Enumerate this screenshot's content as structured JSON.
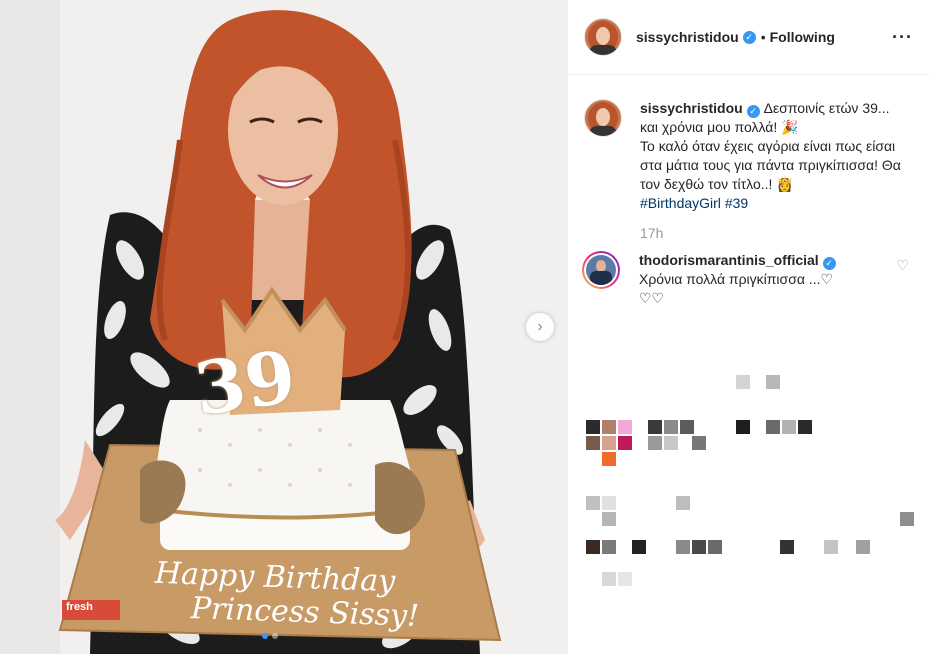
{
  "post": {
    "username": "sissychristidou",
    "follow_separator": "•",
    "follow_status": "Following",
    "more_icon": "···",
    "caption": {
      "username": "sissychristidou",
      "line1": "Δεσποινίς ετών 39... και χρόνια μου πολλά! 🎉",
      "line2": "Το καλό όταν έχεις αγόρια είναι πως είσαι στα μάτια τους για πάντα πριγκίπισσα! Θα τον δεχθώ τον τίτλο..! 👸",
      "hashtag1": "#BirthdayGirl",
      "hashtag2": "#39"
    },
    "time_ago": "17h",
    "comment": {
      "username": "thodorismarantinis_official",
      "text": "Χρόνια πολλά πριγκίπισσα ...♡",
      "hearts": "♡♡"
    },
    "like_icon": "♡",
    "next_icon": "›"
  },
  "photo": {
    "cake_text_line1": "Happy Birthday",
    "cake_text_line2": "Princess Sissy!",
    "cake_number": "39",
    "board_label": "fresh"
  },
  "colors": {
    "accent": "#3897f0",
    "hashtag": "#003569",
    "muted": "#999999"
  }
}
